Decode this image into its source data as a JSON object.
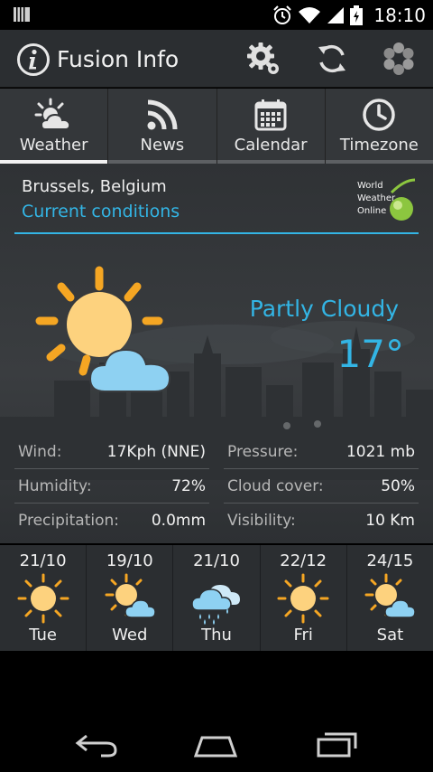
{
  "status_bar": {
    "time": "18:10",
    "icons": [
      "notification-icon",
      "alarm-icon",
      "wifi-icon",
      "signal-icon",
      "battery-icon"
    ]
  },
  "action_bar": {
    "title": "Fusion Info",
    "actions": [
      "settings",
      "refresh",
      "more"
    ]
  },
  "tabs": [
    {
      "label": "Weather",
      "icon": "weather-icon",
      "active": true
    },
    {
      "label": "News",
      "icon": "rss-icon",
      "active": false
    },
    {
      "label": "Calendar",
      "icon": "calendar-icon",
      "active": false
    },
    {
      "label": "Timezone",
      "icon": "clock-icon",
      "active": false
    }
  ],
  "location": "Brussels, Belgium",
  "conditions_link": "Current conditions",
  "provider_logo_text": [
    "World",
    "Weather",
    "Online"
  ],
  "current": {
    "description": "Partly Cloudy",
    "temperature": "17°",
    "icon": "partly-cloudy-icon"
  },
  "details": [
    {
      "label": "Wind:",
      "value": "17Kph (NNE)"
    },
    {
      "label": "Pressure:",
      "value": "1021 mb"
    },
    {
      "label": "Humidity:",
      "value": "72%"
    },
    {
      "label": "Cloud cover:",
      "value": "50%"
    },
    {
      "label": "Precipitation:",
      "value": "0.0mm"
    },
    {
      "label": "Visibility:",
      "value": "10 Km"
    }
  ],
  "forecast": [
    {
      "temps": "21/10",
      "day": "Tue",
      "icon": "sun-icon"
    },
    {
      "temps": "19/10",
      "day": "Wed",
      "icon": "partly-cloudy-icon"
    },
    {
      "temps": "21/10",
      "day": "Thu",
      "icon": "rain-cloud-icon"
    },
    {
      "temps": "22/12",
      "day": "Fri",
      "icon": "sun-icon"
    },
    {
      "temps": "24/15",
      "day": "Sat",
      "icon": "partly-cloudy-icon"
    }
  ],
  "colors": {
    "accent": "#33b5e5",
    "sun": "#fdd27e",
    "sun_rays": "#f5a623",
    "cloud": "#8ed1f2",
    "actionbar": "#2b2e31",
    "tabbar": "#34373a"
  }
}
